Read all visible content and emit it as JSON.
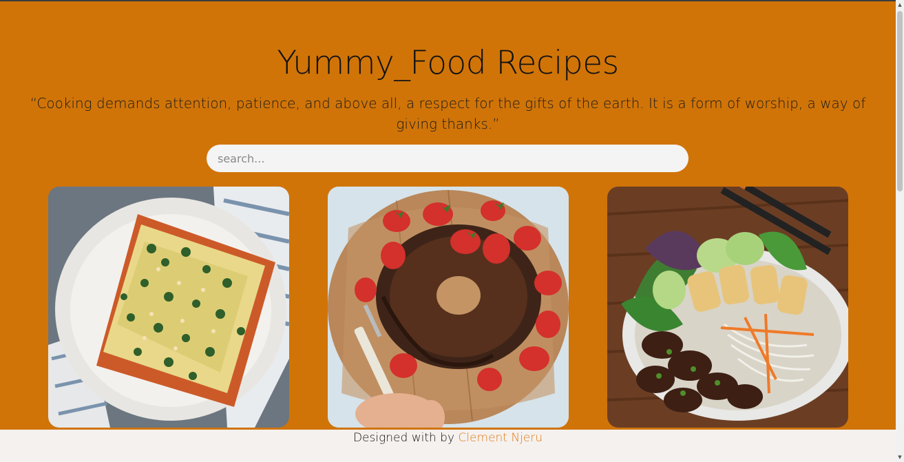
{
  "header": {
    "title": "Yummy_Food Recipes",
    "quote": "“Cooking demands attention, patience, and above all, a respect for the gifts of the earth. It is a form of worship, a way of giving thanks.”"
  },
  "search": {
    "placeholder": "search...",
    "value": ""
  },
  "recipes": [
    {
      "image": "lasagna-photo"
    },
    {
      "image": "chocolate-bundt-cake-photo"
    },
    {
      "image": "vietnamese-noodle-bowl-photo"
    }
  ],
  "footer": {
    "text": "Designed with by ",
    "author": "Clement Njeru"
  },
  "colors": {
    "background": "#d07408",
    "footer_bg": "#f5f1ef",
    "link": "#e07a10"
  }
}
